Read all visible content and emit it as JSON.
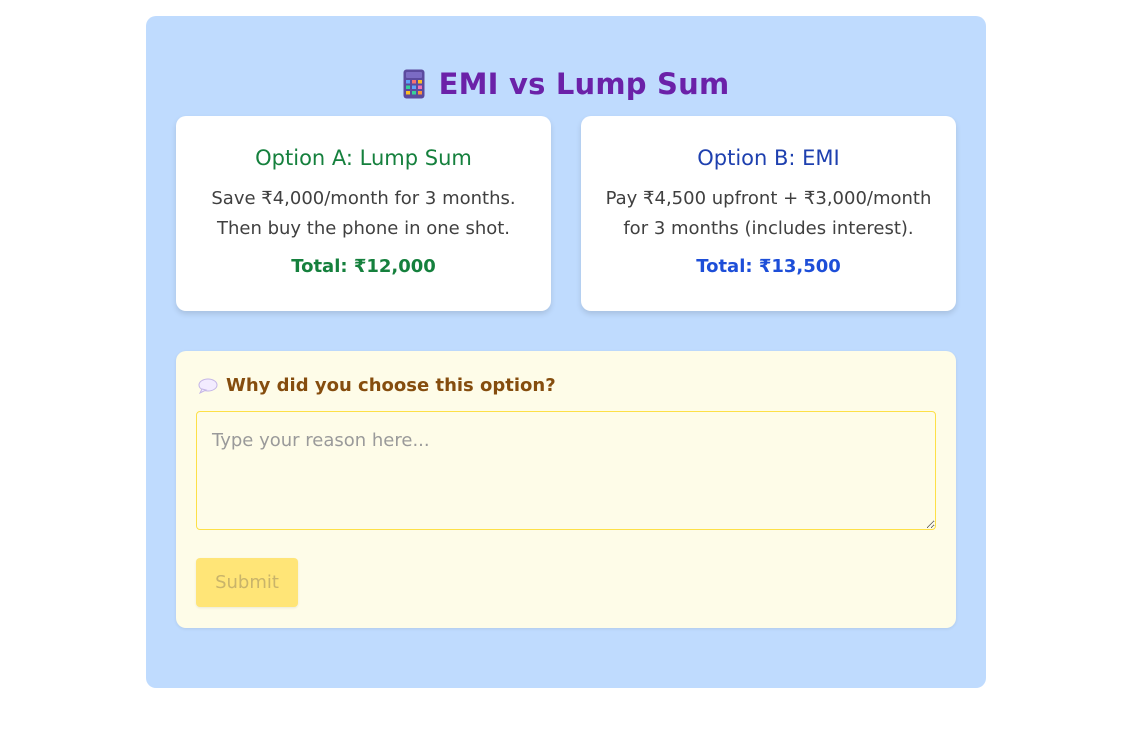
{
  "header": {
    "icon": "calculator-icon",
    "title": "EMI vs Lump Sum",
    "title_color": "#6b21a8"
  },
  "options": [
    {
      "heading": "Option A: Lump Sum",
      "line1": "Save ₹4,000/month for 3 months.",
      "line2": "Then buy the phone in one shot.",
      "total": "Total: ₹12,000",
      "color": "#15803d"
    },
    {
      "heading": "Option B: EMI",
      "line1": "Pay ₹4,500 upfront + ₹3,000/month",
      "line2": "for 3 months (includes interest).",
      "total": "Total: ₹13,500",
      "color": "#1d4ed8"
    }
  ],
  "reason": {
    "icon": "speech-bubble-icon",
    "label": "Why did you choose this option?",
    "placeholder": "Type your reason here...",
    "value": "",
    "submit_label": "Submit",
    "submit_disabled": true
  },
  "colors": {
    "panel_bg": "#bfdbfe",
    "reason_bg": "#fefce8",
    "submit_bg": "#ffe577"
  }
}
